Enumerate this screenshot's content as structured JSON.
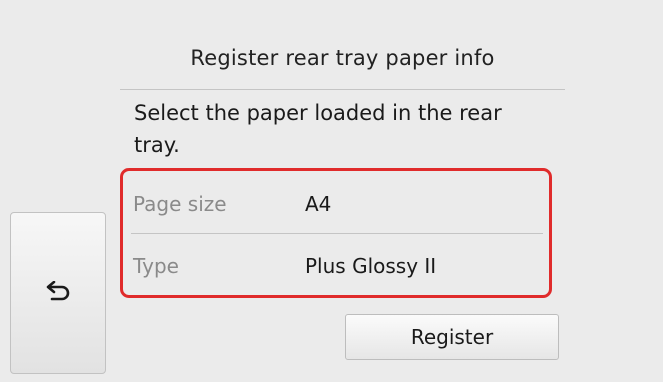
{
  "header": {
    "title": "Register rear tray paper info"
  },
  "message": "Select the paper loaded in the rear tray.",
  "settings": {
    "rows": [
      {
        "label": "Page size",
        "value": "A4"
      },
      {
        "label": "Type",
        "value": "Plus Glossy II"
      }
    ],
    "highlight_color": "#e02b2b"
  },
  "buttons": {
    "back_icon": "back-arrow-icon",
    "register_label": "Register"
  }
}
